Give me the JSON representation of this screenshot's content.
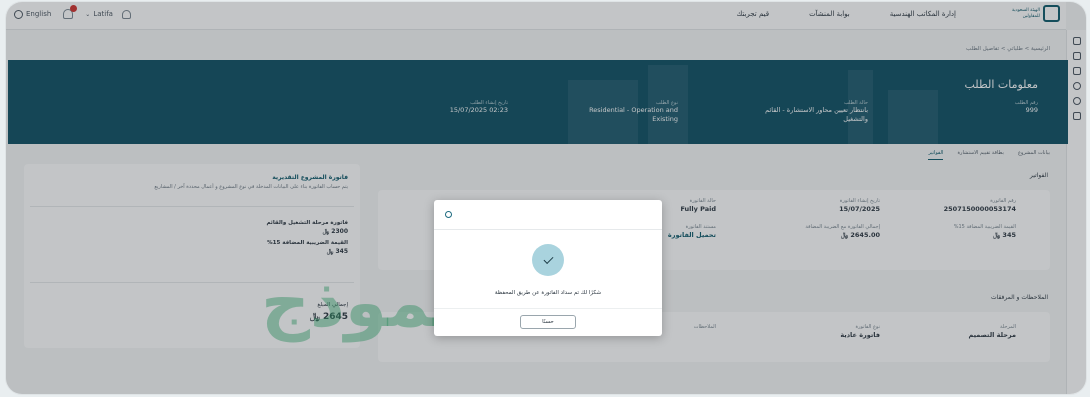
{
  "topbar": {
    "language": "English",
    "user_label": "Latifa",
    "nav": [
      "إدارة المكاتب الهندسية",
      "بوابة المنشآت",
      "قيم تجربتك"
    ],
    "logo_text_1": "الهيئة السعودية",
    "logo_text_2": "للمقاولين"
  },
  "breadcrumb": "الرئيسية  >  طلباتي  >  تفاصيل الطلب",
  "banner": {
    "title": "معلومات الطلب",
    "request_number_label": "رقم الطلب",
    "request_number": "999",
    "status_label": "حالة الطلب",
    "status": "بانتظار تعيين محاور الاستشارة - القائم والتشغيل",
    "type_label": "نوع الطلب",
    "type": "Residential - Operation and Existing",
    "date_label": "تاريخ إنشاء الطلب",
    "date": "02:23 15/07/2025"
  },
  "tabs": [
    "بيانات المشروع",
    "بطاقة تقييم الاستشارة",
    "الفواتير"
  ],
  "invoices": {
    "section_title": "الفواتير",
    "invoice_number_label": "رقم الفاتورة",
    "invoice_number": "2507150000053174",
    "invoice_date_label": "تاريخ إنشاء الفاتورة",
    "invoice_date": "15/07/2025",
    "status_label": "حالة الفاتورة",
    "status": "Fully Paid",
    "vat_label": "القيمة الضريبية المضافة 15%",
    "vat": "345 ﷼",
    "total_label": "إجمالي الفاتورة مع الضريبة المضافة",
    "total": "2645.00 ﷼",
    "doc_label": "مستند الفاتورة",
    "doc_link": "تحميل الفاتورة"
  },
  "notes": {
    "section_title": "الملاحظات و المرفقات",
    "stage_label": "المرحلة",
    "stage": "مرحلة التصميم",
    "invoice_type_label": "نوع الفاتورة",
    "invoice_type": "فاتورة عادية",
    "remarks_label": "الملاحظات"
  },
  "side_panel": {
    "title": "فاتورة المشروع التقديرية",
    "desc": "يتم حساب الفاتورة بناء على البيانات المدخلة في نوع المشروع و أعمال محددة آخر / المشاريع",
    "stage_label": "فاتورة مرحلة التشغيل والقائم",
    "stage_value": "2300 ﷼",
    "vat_label": "القيمة الضريبية المضافة 15%",
    "vat_value": "345 ﷼",
    "total_label": "إجمالي المبلغ",
    "total_value": "2645 ﷼"
  },
  "watermark": "نموذج",
  "modal": {
    "message": "شكرًا لك تم سداد الفاتورة عن طريق المحفظة",
    "ok_label": "حسنًا"
  }
}
